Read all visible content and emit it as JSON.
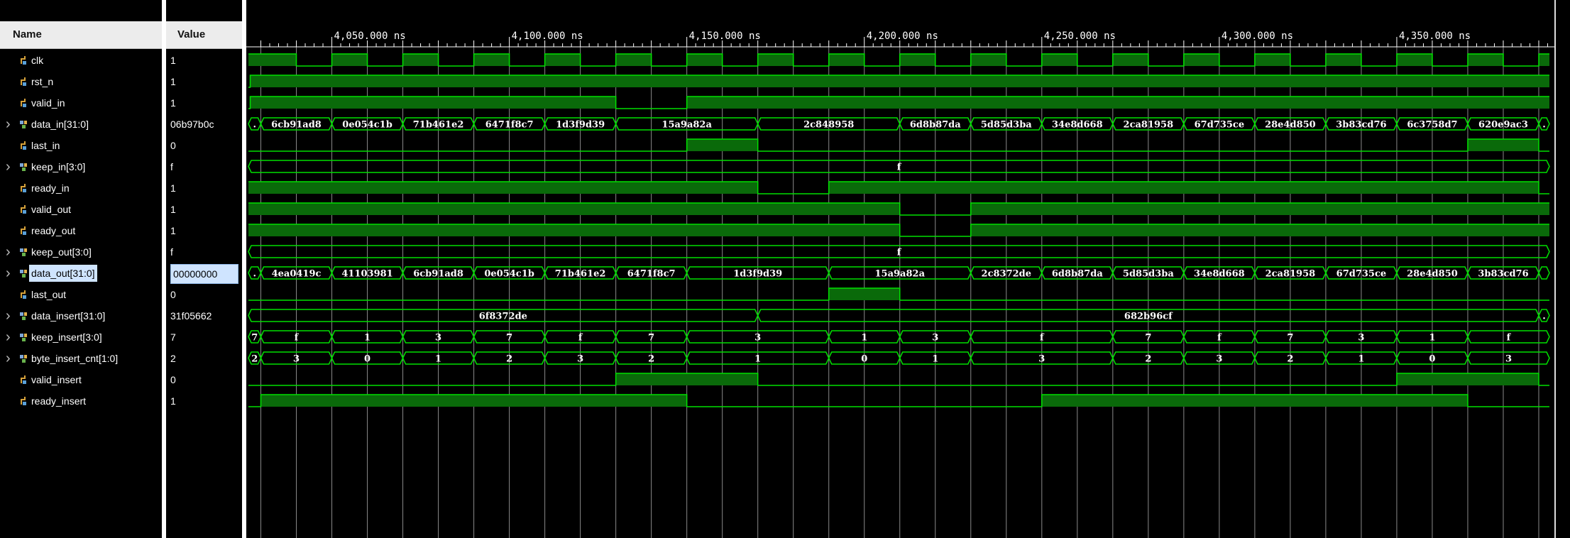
{
  "headers": {
    "name": "Name",
    "value": "Value"
  },
  "colors": {
    "wave": "#00e000",
    "wave_fill": "#0a6a0a",
    "bus_text": "#ffffff",
    "grid": "#8a8a8a",
    "selection": "#cfe4ff"
  },
  "time_axis": {
    "unit": "ns",
    "view_start": 4026.5,
    "view_end": 4393,
    "labels": [
      {
        "t": 4050,
        "text": "4,050.000 ns"
      },
      {
        "t": 4100,
        "text": "4,100.000 ns"
      },
      {
        "t": 4150,
        "text": "4,150.000 ns"
      },
      {
        "t": 4200,
        "text": "4,200.000 ns"
      },
      {
        "t": 4250,
        "text": "4,250.000 ns"
      },
      {
        "t": 4300,
        "text": "4,300.000 ns"
      },
      {
        "t": 4350,
        "text": "4,350.000 ns"
      }
    ]
  },
  "signals": [
    {
      "name": "clk",
      "value": "1",
      "kind": "bit",
      "expandable": false,
      "icon": "bit-signal-icon",
      "selected": false,
      "clock": {
        "first_rise": 4030,
        "period": 20,
        "high": 10
      }
    },
    {
      "name": "rst_n",
      "value": "1",
      "kind": "bit",
      "expandable": false,
      "icon": "bit-signal-icon",
      "selected": false,
      "edges": [
        [
          4026.5,
          0
        ],
        [
          4027,
          1
        ]
      ]
    },
    {
      "name": "valid_in",
      "value": "1",
      "kind": "bit",
      "expandable": false,
      "icon": "bit-signal-icon",
      "selected": false,
      "edges": [
        [
          4026.5,
          0
        ],
        [
          4027,
          1
        ],
        [
          4130,
          0
        ],
        [
          4150,
          1
        ]
      ]
    },
    {
      "name": "data_in[31:0]",
      "value": "06b97b0c",
      "kind": "bus",
      "expandable": true,
      "icon": "bus-signal-icon",
      "selected": false,
      "segments": [
        [
          4026.5,
          4030,
          "."
        ],
        [
          4030,
          4050,
          "6cb91ad8"
        ],
        [
          4050,
          4070,
          "0e054c1b"
        ],
        [
          4070,
          4090,
          "71b461e2"
        ],
        [
          4090,
          4110,
          "6471f8c7"
        ],
        [
          4110,
          4130,
          "1d3f9d39"
        ],
        [
          4130,
          4170,
          "15a9a82a"
        ],
        [
          4170,
          4210,
          "2c848958"
        ],
        [
          4210,
          4230,
          "6d8b87da"
        ],
        [
          4230,
          4250,
          "5d85d3ba"
        ],
        [
          4250,
          4270,
          "34e8d668"
        ],
        [
          4270,
          4290,
          "2ca81958"
        ],
        [
          4290,
          4310,
          "67d735ce"
        ],
        [
          4310,
          4330,
          "28e4d850"
        ],
        [
          4330,
          4350,
          "3b83cd76"
        ],
        [
          4350,
          4370,
          "6c3758d7"
        ],
        [
          4370,
          4390,
          "620e9ac3"
        ],
        [
          4390,
          4393,
          "."
        ]
      ]
    },
    {
      "name": "last_in",
      "value": "0",
      "kind": "bit",
      "expandable": false,
      "icon": "bit-signal-icon",
      "selected": false,
      "edges": [
        [
          4026.5,
          0
        ],
        [
          4150,
          1
        ],
        [
          4170,
          0
        ],
        [
          4370,
          1
        ],
        [
          4390,
          0
        ]
      ]
    },
    {
      "name": "keep_in[3:0]",
      "value": "f",
      "kind": "bus",
      "expandable": true,
      "icon": "bus-signal-icon",
      "selected": false,
      "segments": [
        [
          4026.5,
          4393,
          "f"
        ]
      ]
    },
    {
      "name": "ready_in",
      "value": "1",
      "kind": "bit",
      "expandable": false,
      "icon": "bit-signal-icon",
      "selected": false,
      "edges": [
        [
          4026.5,
          1
        ],
        [
          4170,
          0
        ],
        [
          4190,
          1
        ],
        [
          4390,
          0
        ]
      ]
    },
    {
      "name": "valid_out",
      "value": "1",
      "kind": "bit",
      "expandable": false,
      "icon": "bit-signal-icon",
      "selected": false,
      "edges": [
        [
          4026.5,
          1
        ],
        [
          4210,
          0
        ],
        [
          4230,
          1
        ]
      ]
    },
    {
      "name": "ready_out",
      "value": "1",
      "kind": "bit",
      "expandable": false,
      "icon": "bit-signal-icon",
      "selected": false,
      "edges": [
        [
          4026.5,
          1
        ],
        [
          4210,
          0
        ],
        [
          4230,
          1
        ]
      ]
    },
    {
      "name": "keep_out[3:0]",
      "value": "f",
      "kind": "bus",
      "expandable": true,
      "icon": "bus-signal-icon",
      "selected": false,
      "segments": [
        [
          4026.5,
          4393,
          "f"
        ]
      ]
    },
    {
      "name": "data_out[31:0]",
      "value": "00000000",
      "kind": "bus",
      "expandable": true,
      "icon": "bus-signal-icon",
      "selected": true,
      "segments": [
        [
          4026.5,
          4030,
          "."
        ],
        [
          4030,
          4050,
          "4ea0419c"
        ],
        [
          4050,
          4070,
          "41103981"
        ],
        [
          4070,
          4090,
          "6cb91ad8"
        ],
        [
          4090,
          4110,
          "0e054c1b"
        ],
        [
          4110,
          4130,
          "71b461e2"
        ],
        [
          4130,
          4150,
          "6471f8c7"
        ],
        [
          4150,
          4190,
          "1d3f9d39"
        ],
        [
          4190,
          4230,
          "15a9a82a"
        ],
        [
          4230,
          4250,
          "2c8372de"
        ],
        [
          4250,
          4270,
          "6d8b87da"
        ],
        [
          4270,
          4290,
          "5d85d3ba"
        ],
        [
          4290,
          4310,
          "34e8d668"
        ],
        [
          4310,
          4330,
          "2ca81958"
        ],
        [
          4330,
          4350,
          "67d735ce"
        ],
        [
          4350,
          4370,
          "28e4d850"
        ],
        [
          4370,
          4390,
          "3b83cd76"
        ],
        [
          4390,
          4393,
          ""
        ]
      ]
    },
    {
      "name": "last_out",
      "value": "0",
      "kind": "bit",
      "expandable": false,
      "icon": "bit-signal-icon",
      "selected": false,
      "edges": [
        [
          4026.5,
          0
        ],
        [
          4190,
          1
        ],
        [
          4210,
          0
        ]
      ]
    },
    {
      "name": "data_insert[31:0]",
      "value": "31f05662",
      "kind": "bus",
      "expandable": true,
      "icon": "bus-signal-icon",
      "selected": false,
      "segments": [
        [
          4026.5,
          4170,
          "6f8372de"
        ],
        [
          4170,
          4390,
          "682b96cf"
        ],
        [
          4390,
          4393,
          "."
        ]
      ]
    },
    {
      "name": "keep_insert[3:0]",
      "value": "7",
      "kind": "bus",
      "expandable": true,
      "icon": "bus-signal-icon",
      "selected": false,
      "segments": [
        [
          4026.5,
          4030,
          "7"
        ],
        [
          4030,
          4050,
          "f"
        ],
        [
          4050,
          4070,
          "1"
        ],
        [
          4070,
          4090,
          "3"
        ],
        [
          4090,
          4110,
          "7"
        ],
        [
          4110,
          4130,
          "f"
        ],
        [
          4130,
          4150,
          "7"
        ],
        [
          4150,
          4190,
          "3"
        ],
        [
          4190,
          4210,
          "1"
        ],
        [
          4210,
          4230,
          "3"
        ],
        [
          4230,
          4270,
          "f"
        ],
        [
          4270,
          4290,
          "7"
        ],
        [
          4290,
          4310,
          "f"
        ],
        [
          4310,
          4330,
          "7"
        ],
        [
          4330,
          4350,
          "3"
        ],
        [
          4350,
          4370,
          "1"
        ],
        [
          4370,
          4393,
          "f"
        ]
      ]
    },
    {
      "name": "byte_insert_cnt[1:0]",
      "value": "2",
      "kind": "bus",
      "expandable": true,
      "icon": "bus-signal-icon",
      "selected": false,
      "segments": [
        [
          4026.5,
          4030,
          "2"
        ],
        [
          4030,
          4050,
          "3"
        ],
        [
          4050,
          4070,
          "0"
        ],
        [
          4070,
          4090,
          "1"
        ],
        [
          4090,
          4110,
          "2"
        ],
        [
          4110,
          4130,
          "3"
        ],
        [
          4130,
          4150,
          "2"
        ],
        [
          4150,
          4190,
          "1"
        ],
        [
          4190,
          4210,
          "0"
        ],
        [
          4210,
          4230,
          "1"
        ],
        [
          4230,
          4270,
          "3"
        ],
        [
          4270,
          4290,
          "2"
        ],
        [
          4290,
          4310,
          "3"
        ],
        [
          4310,
          4330,
          "2"
        ],
        [
          4330,
          4350,
          "1"
        ],
        [
          4350,
          4370,
          "0"
        ],
        [
          4370,
          4393,
          "3"
        ]
      ]
    },
    {
      "name": "valid_insert",
      "value": "0",
      "kind": "bit",
      "expandable": false,
      "icon": "bit-signal-icon",
      "selected": false,
      "edges": [
        [
          4026.5,
          0
        ],
        [
          4130,
          1
        ],
        [
          4170,
          0
        ],
        [
          4350,
          1
        ],
        [
          4390,
          0
        ]
      ]
    },
    {
      "name": "ready_insert",
      "value": "1",
      "kind": "bit",
      "expandable": false,
      "icon": "bit-signal-icon",
      "selected": false,
      "edges": [
        [
          4026.5,
          0
        ],
        [
          4030,
          1
        ],
        [
          4150,
          0
        ],
        [
          4250,
          1
        ],
        [
          4370,
          0
        ]
      ]
    }
  ]
}
